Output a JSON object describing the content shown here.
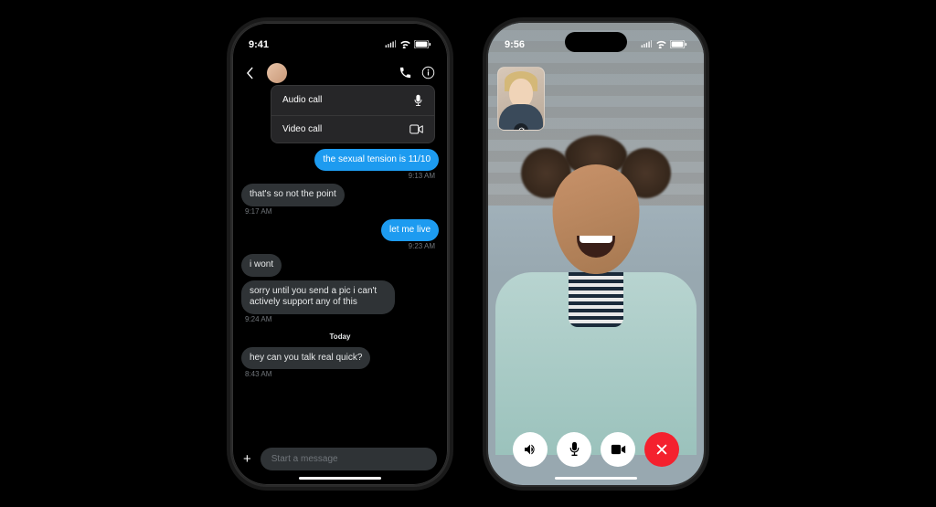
{
  "phone1": {
    "status": {
      "time": "9:41"
    },
    "menu": {
      "audio": "Audio call",
      "video": "Video call"
    },
    "messages": [
      {
        "side": "sent",
        "text": "the sexual tension is 11/10",
        "time": "9:13 AM"
      },
      {
        "side": "received",
        "text": "that's so not the point",
        "time": "9:17 AM"
      },
      {
        "side": "sent",
        "text": "let me live",
        "time": "9:23 AM"
      },
      {
        "side": "received",
        "text": "i wont",
        "time": ""
      },
      {
        "side": "received",
        "text": "sorry until you send a pic i can't actively support any of this",
        "time": "9:24 AM"
      }
    ],
    "divider": "Today",
    "messages_after": [
      {
        "side": "received",
        "text": "hey can you talk real quick?",
        "time": "8:43 AM"
      }
    ],
    "composer": {
      "placeholder": "Start a message"
    }
  },
  "phone2": {
    "status": {
      "time": "9:56"
    }
  }
}
